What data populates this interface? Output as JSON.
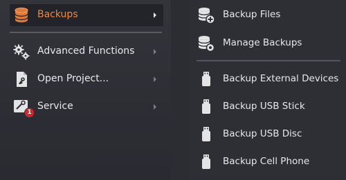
{
  "colors": {
    "background": "#2c2c33",
    "active_label": "#f0883a",
    "icon": "#e4e4e6",
    "badge": "#d2262a",
    "database_icon": "#e07a3a"
  },
  "left_menu": {
    "items": [
      {
        "label": "Backups",
        "icon": "database-icon",
        "active": true,
        "has_submenu": true
      },
      {
        "label": "Advanced Functions",
        "icon": "gears-icon",
        "active": false,
        "has_submenu": true
      },
      {
        "label": "Open Project...",
        "icon": "project-file-icon",
        "active": false,
        "has_submenu": true
      },
      {
        "label": "Service",
        "icon": "service-icon",
        "active": false,
        "has_submenu": true,
        "badge": "1"
      }
    ]
  },
  "submenu": {
    "items": [
      {
        "label": "Backup Files",
        "icon": "database-add-icon"
      },
      {
        "label": "Manage Backups",
        "icon": "database-settings-icon"
      },
      {
        "label": "Backup External Devices",
        "icon": "usb-drive-icon"
      },
      {
        "label": "Backup USB Stick",
        "icon": "usb-drive-icon"
      },
      {
        "label": "Backup USB Disc",
        "icon": "usb-drive-icon"
      },
      {
        "label": "Backup Cell Phone",
        "icon": "usb-drive-icon"
      }
    ]
  }
}
